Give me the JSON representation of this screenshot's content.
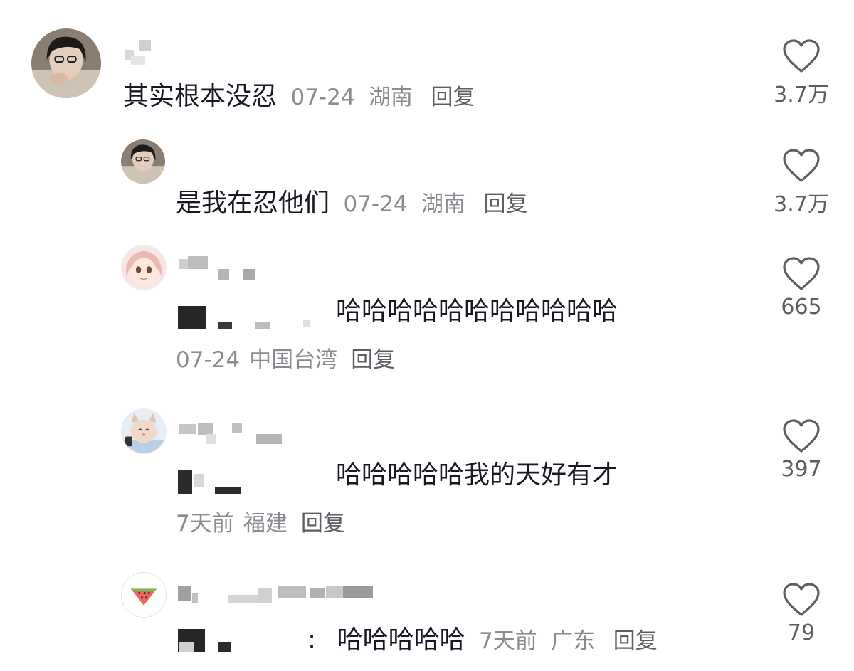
{
  "comments": [
    {
      "text": "其实根本没忍",
      "time": "07-24",
      "location": "湖南",
      "reply_label": "回复",
      "likes": "3.7万"
    },
    {
      "text": "是我在忍他们",
      "time": "07-24",
      "location": "湖南",
      "reply_label": "回复",
      "likes": "3.7万"
    },
    {
      "text": "哈哈哈哈哈哈哈哈哈哈哈",
      "time": "07-24",
      "location": "中国台湾",
      "reply_label": "回复",
      "likes": "665"
    },
    {
      "text": "哈哈哈哈哈我的天好有才",
      "time": "7天前",
      "location": "福建",
      "reply_label": "回复",
      "likes": "397"
    },
    {
      "text": "哈哈哈哈哈",
      "time": "7天前",
      "location": "广东",
      "reply_label": "回复",
      "likes": "79",
      "prefix": ":"
    }
  ],
  "icons": {
    "like": "heart-outline-icon"
  },
  "colors": {
    "text": "#161823",
    "meta": "#8a8b91",
    "icon": "#5d5e63"
  }
}
